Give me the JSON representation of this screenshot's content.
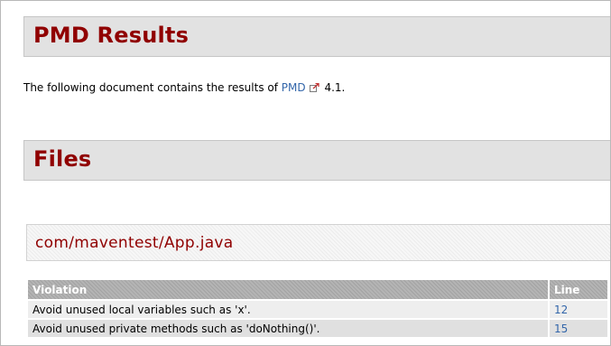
{
  "title": "PMD Results",
  "intro": {
    "prefix": "The following document contains the results of ",
    "link": "PMD",
    "suffix": " 4.1."
  },
  "files_title": "Files",
  "file": {
    "path": "com/maventest/App.java"
  },
  "table": {
    "headers": [
      "Violation",
      "Line"
    ],
    "rows": [
      {
        "violation": "Avoid unused local variables such as 'x'.",
        "line": "12"
      },
      {
        "violation": "Avoid unused private methods such as 'doNothing()'.",
        "line": "15"
      }
    ]
  },
  "colors": {
    "heading": "#900000",
    "link": "#3366aa",
    "header_bar": "#e2e2e2"
  },
  "icons": [
    "external-link-icon"
  ]
}
